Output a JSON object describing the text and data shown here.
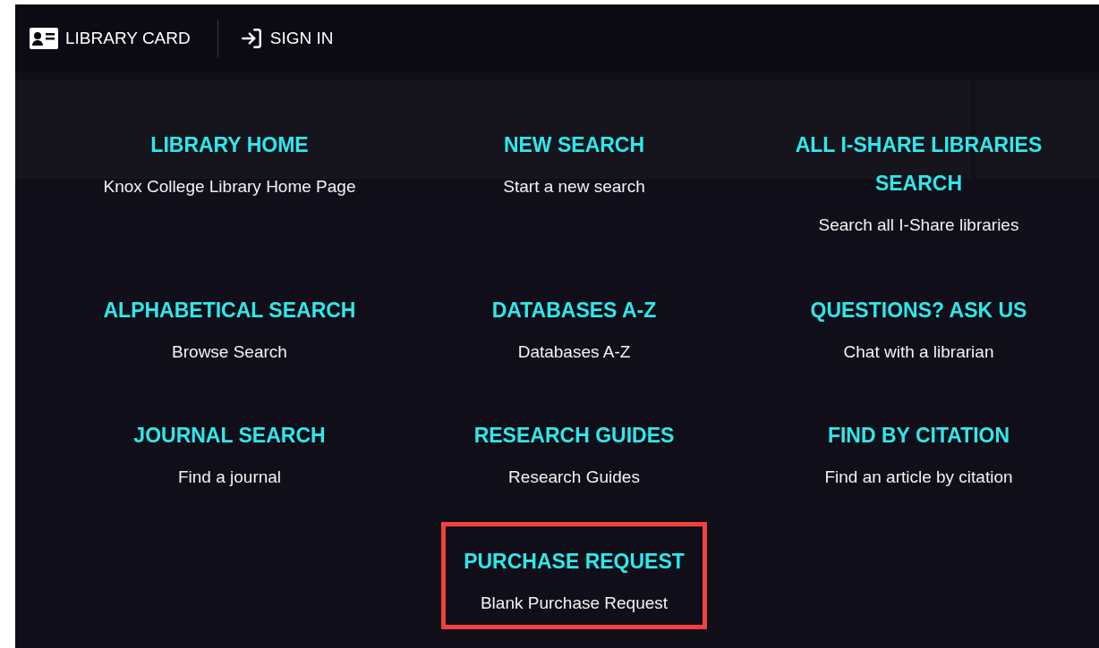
{
  "header": {
    "buttons": [
      {
        "kind": "card",
        "label": "LIBRARY CARD"
      },
      {
        "kind": "signin",
        "label": "SIGN IN"
      }
    ]
  },
  "menu": {
    "items": [
      {
        "title": "LIBRARY HOME",
        "description": "Knox College Library Home Page",
        "highlighted": false
      },
      {
        "title": "NEW SEARCH",
        "description": "Start a new search",
        "highlighted": false
      },
      {
        "title": "ALL I-SHARE LIBRARIES SEARCH",
        "description": "Search all I-Share libraries",
        "highlighted": false
      },
      {
        "title": "ALPHABETICAL SEARCH",
        "description": "Browse Search",
        "highlighted": false
      },
      {
        "title": "DATABASES A-Z",
        "description": "Databases A-Z",
        "highlighted": false
      },
      {
        "title": "QUESTIONS? ASK US",
        "description": "Chat with a librarian",
        "highlighted": false
      },
      {
        "title": "JOURNAL SEARCH",
        "description": "Find a journal",
        "highlighted": false
      },
      {
        "title": "RESEARCH GUIDES",
        "description": "Research Guides",
        "highlighted": false
      },
      {
        "title": "FIND BY CITATION",
        "description": "Find an article by citation",
        "highlighted": false
      },
      {
        "title": "PURCHASE REQUEST",
        "description": "Blank Purchase Request",
        "highlighted": true
      }
    ]
  }
}
